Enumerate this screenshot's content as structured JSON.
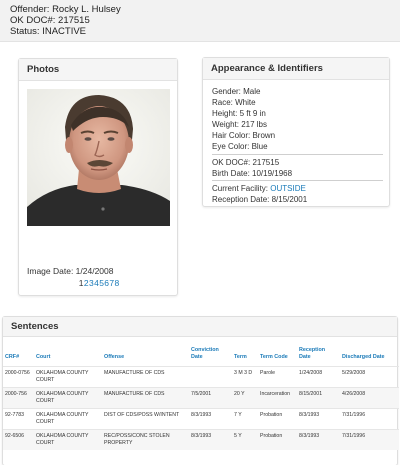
{
  "header": {
    "offender_line": "Offender: Rocky L. Hulsey",
    "doc_line": "OK DOC#: 217515",
    "status_line": "Status: INACTIVE"
  },
  "photos": {
    "title": "Photos",
    "image_date_label": "Image Date: 1/24/2008",
    "pages": [
      "1",
      "2",
      "3",
      "4",
      "5",
      "6",
      "7",
      "8"
    ],
    "current_page": "1"
  },
  "appearance": {
    "title": "Appearance & Identifiers",
    "gender": "Gender: Male",
    "race": "Race: White",
    "height": "Height: 5 ft 9 in",
    "weight": "Weight: 217 lbs",
    "hair": "Hair Color: Brown",
    "eye": "Eye Color: Blue",
    "doc": "OK DOC#: 217515",
    "birth": "Birth Date: 10/19/1968",
    "facility_label": "Current Facility:",
    "facility_value": "OUTSIDE",
    "reception": "Reception Date: 8/15/2001"
  },
  "sentences": {
    "title": "Sentences",
    "columns": [
      "CRF#",
      "Court",
      "Offense",
      "Conviction Date",
      "Term",
      "Term Code",
      "Reception Date",
      "Discharged Date"
    ],
    "rows": [
      [
        "2000-0756",
        "OKLAHOMA COUNTY COURT",
        "MANUFACTURE OF CDS",
        "",
        "3 M 3 D",
        "Parole",
        "1/24/2008",
        "5/29/2008"
      ],
      [
        "2000-756",
        "OKLAHOMA COUNTY COURT",
        "MANUFACTURE OF CDS",
        "7/5/2001",
        "20 Y",
        "Incarceration",
        "8/15/2001",
        "4/26/2008"
      ],
      [
        "92-7783",
        "OKLAHOMA COUNTY COURT",
        "DIST OF CDS/POSS W/INTENT",
        "8/3/1993",
        "7 Y",
        "Probation",
        "8/3/1993",
        "7/31/1996"
      ],
      [
        "92-6506",
        "OKLAHOMA COUNTY COURT",
        "REC/POSS/CONC STOLEN PROPERTY",
        "8/3/1993",
        "5 Y",
        "Probation",
        "8/3/1993",
        "7/31/1996"
      ]
    ]
  },
  "colors": {
    "link": "#1a7ab8",
    "header_bg": "#f2f2f2",
    "card_title_bg": "#f5f5f5"
  }
}
